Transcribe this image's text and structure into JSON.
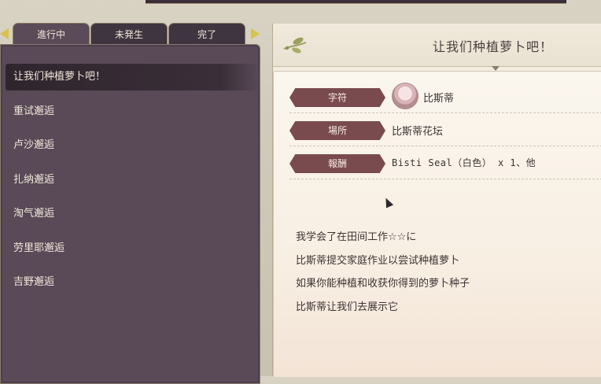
{
  "tabs": [
    {
      "label": "進行中",
      "active": true
    },
    {
      "label": "未発生",
      "active": false
    },
    {
      "label": "完了",
      "active": false
    }
  ],
  "quests": [
    {
      "label": "让我们种植萝卜吧！",
      "selected": true
    },
    {
      "label": "重试邂逅"
    },
    {
      "label": "卢沙邂逅"
    },
    {
      "label": "扎纳邂逅"
    },
    {
      "label": "淘气邂逅"
    },
    {
      "label": "劳里耶邂逅"
    },
    {
      "label": "吉野邂逅"
    }
  ],
  "detail": {
    "title": "让我们种植萝卜吧！",
    "rows": {
      "character": {
        "label": "字符",
        "value": "比斯蒂"
      },
      "location": {
        "label": "場所",
        "value": "比斯蒂花坛"
      },
      "reward": {
        "label": "報酬",
        "value": "Bisti Seal（白色） x 1、他"
      }
    },
    "description": [
      "我学会了在田间工作☆☆に",
      "比斯蒂提交家庭作业以尝试种植萝卜",
      "如果你能种植和收获你得到的萝卜种子",
      "比斯蒂让我们去展示它"
    ]
  },
  "colors": {
    "panel_bg": "#5a4a58",
    "tab_active": "#5b4b58",
    "pill": "#7a4b4e",
    "arrow": "#d9c24a",
    "detail_bg": "#fbf6ee"
  }
}
